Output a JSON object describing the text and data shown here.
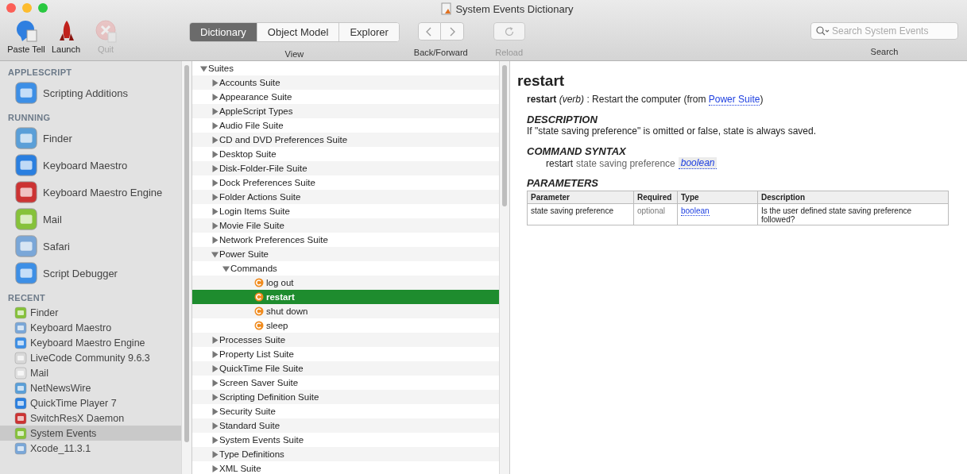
{
  "window": {
    "title": "System Events Dictionary"
  },
  "toolbar": {
    "tools": [
      {
        "label": "Paste Tell",
        "disabled": false
      },
      {
        "label": "Launch",
        "disabled": false
      },
      {
        "label": "Quit",
        "disabled": true
      }
    ],
    "view_tabs": [
      {
        "label": "Dictionary",
        "selected": true
      },
      {
        "label": "Object Model",
        "selected": false
      },
      {
        "label": "Explorer",
        "selected": false
      }
    ],
    "view_label": "View",
    "nav_label": "Back/Forward",
    "reload": {
      "label": "Reload",
      "disabled": true
    },
    "search": {
      "placeholder": "Search System Events",
      "label": "Search"
    }
  },
  "sidebar": {
    "sections": [
      {
        "title": "APPLESCRIPT",
        "kind": "large",
        "items": [
          {
            "label": "Scripting Additions",
            "selected": false
          }
        ]
      },
      {
        "title": "RUNNING",
        "kind": "large",
        "items": [
          {
            "label": "Finder",
            "selected": false
          },
          {
            "label": "Keyboard Maestro",
            "selected": false
          },
          {
            "label": "Keyboard Maestro Engine",
            "selected": false
          },
          {
            "label": "Mail",
            "selected": false
          },
          {
            "label": "Safari",
            "selected": false
          },
          {
            "label": "Script Debugger",
            "selected": false
          }
        ]
      },
      {
        "title": "RECENT",
        "kind": "small",
        "items": [
          {
            "label": "Finder",
            "selected": false
          },
          {
            "label": "Keyboard Maestro",
            "selected": false
          },
          {
            "label": "Keyboard Maestro Engine",
            "selected": false
          },
          {
            "label": "LiveCode Community 9.6.3",
            "selected": false
          },
          {
            "label": "Mail",
            "selected": false
          },
          {
            "label": "NetNewsWire",
            "selected": false
          },
          {
            "label": "QuickTime Player 7",
            "selected": false
          },
          {
            "label": "SwitchResX Daemon",
            "selected": false
          },
          {
            "label": "System Events",
            "selected": true
          },
          {
            "label": "Xcode_11.3.1",
            "selected": false
          }
        ]
      }
    ]
  },
  "tree": {
    "label": "Suites",
    "kind": "group",
    "expanded": true,
    "children": [
      {
        "label": "Accounts Suite",
        "kind": "group",
        "expanded": false
      },
      {
        "label": "Appearance Suite",
        "kind": "group",
        "expanded": false
      },
      {
        "label": "AppleScript Types",
        "kind": "group",
        "expanded": false
      },
      {
        "label": "Audio File Suite",
        "kind": "group",
        "expanded": false
      },
      {
        "label": "CD and DVD Preferences Suite",
        "kind": "group",
        "expanded": false
      },
      {
        "label": "Desktop Suite",
        "kind": "group",
        "expanded": false
      },
      {
        "label": "Disk-Folder-File Suite",
        "kind": "group",
        "expanded": false
      },
      {
        "label": "Dock Preferences Suite",
        "kind": "group",
        "expanded": false
      },
      {
        "label": "Folder Actions Suite",
        "kind": "group",
        "expanded": false
      },
      {
        "label": "Login Items Suite",
        "kind": "group",
        "expanded": false
      },
      {
        "label": "Movie File Suite",
        "kind": "group",
        "expanded": false
      },
      {
        "label": "Network Preferences Suite",
        "kind": "group",
        "expanded": false
      },
      {
        "label": "Power Suite",
        "kind": "group",
        "expanded": true,
        "children": [
          {
            "label": "Commands",
            "kind": "group",
            "expanded": true,
            "children": [
              {
                "label": "log out",
                "kind": "command",
                "selected": false
              },
              {
                "label": "restart",
                "kind": "command",
                "selected": true
              },
              {
                "label": "shut down",
                "kind": "command",
                "selected": false
              },
              {
                "label": "sleep",
                "kind": "command",
                "selected": false
              }
            ]
          }
        ]
      },
      {
        "label": "Processes Suite",
        "kind": "group",
        "expanded": false
      },
      {
        "label": "Property List Suite",
        "kind": "group",
        "expanded": false
      },
      {
        "label": "QuickTime File Suite",
        "kind": "group",
        "expanded": false
      },
      {
        "label": "Screen Saver Suite",
        "kind": "group",
        "expanded": false
      },
      {
        "label": "Scripting Definition Suite",
        "kind": "group",
        "expanded": false
      },
      {
        "label": "Security Suite",
        "kind": "group",
        "expanded": false
      },
      {
        "label": "Standard Suite",
        "kind": "group",
        "expanded": false
      },
      {
        "label": "System Events Suite",
        "kind": "group",
        "expanded": false
      },
      {
        "label": "Type Definitions",
        "kind": "group",
        "expanded": false
      },
      {
        "label": "XML Suite",
        "kind": "group",
        "expanded": false
      }
    ]
  },
  "detail": {
    "title": "restart",
    "summary": {
      "text": "**restart** *(verb)* : Restart the computer (from ",
      "link": "Power Suite",
      "after": ")"
    },
    "description_heading": "DESCRIPTION",
    "description": "If \"state saving preference\" is omitted or false, state is always saved.",
    "syntax_heading": "COMMAND SYNTAX",
    "syntax": {
      "command": "restart",
      "parameter": "state saving preference",
      "type": "boolean"
    },
    "parameters_heading": "PARAMETERS",
    "table": {
      "columns": [
        "Parameter",
        "Required",
        "Type",
        "Description"
      ],
      "rows": [
        {
          "parameter": "state saving preference",
          "required": "optional",
          "type": "boolean",
          "description": "Is the user defined state saving preference followed?"
        }
      ]
    }
  }
}
